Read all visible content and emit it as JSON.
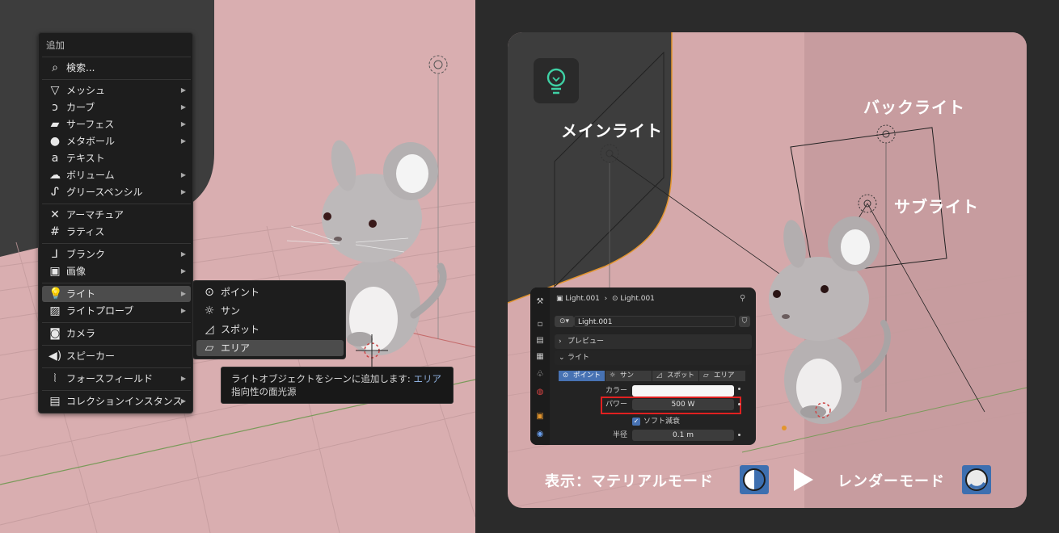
{
  "add_menu": {
    "title": "追加",
    "search": "検索...",
    "items": [
      {
        "label": "メッシュ",
        "icon": "mesh-icon",
        "has_submenu": true
      },
      {
        "label": "カーブ",
        "icon": "curve-icon",
        "has_submenu": true
      },
      {
        "label": "サーフェス",
        "icon": "surface-icon",
        "has_submenu": true
      },
      {
        "label": "メタボール",
        "icon": "metaball-icon",
        "has_submenu": true
      },
      {
        "label": "テキスト",
        "icon": "text-icon",
        "has_submenu": false
      },
      {
        "label": "ボリューム",
        "icon": "volume-icon",
        "has_submenu": true
      },
      {
        "label": "グリースペンシル",
        "icon": "grease-pencil-icon",
        "has_submenu": true
      },
      {
        "label": "アーマチュア",
        "icon": "armature-icon",
        "has_submenu": false
      },
      {
        "label": "ラティス",
        "icon": "lattice-icon",
        "has_submenu": false
      },
      {
        "label": "ブランク",
        "icon": "empty-icon",
        "has_submenu": true
      },
      {
        "label": "画像",
        "icon": "image-icon",
        "has_submenu": true
      },
      {
        "label": "ライト",
        "icon": "light-icon",
        "has_submenu": true,
        "active": true
      },
      {
        "label": "ライトプローブ",
        "icon": "light-probe-icon",
        "has_submenu": true
      },
      {
        "label": "カメラ",
        "icon": "camera-icon",
        "has_submenu": false
      },
      {
        "label": "スピーカー",
        "icon": "speaker-icon",
        "has_submenu": false
      },
      {
        "label": "フォースフィールド",
        "icon": "force-field-icon",
        "has_submenu": true
      },
      {
        "label": "コレクションインスタンス",
        "icon": "collection-icon",
        "has_submenu": true
      }
    ]
  },
  "light_submenu": {
    "items": [
      {
        "label": "ポイント",
        "icon": "point-light-icon"
      },
      {
        "label": "サン",
        "icon": "sun-light-icon"
      },
      {
        "label": "スポット",
        "icon": "spot-light-icon"
      },
      {
        "label": "エリア",
        "icon": "area-light-icon",
        "highlighted": true
      }
    ]
  },
  "tooltip": {
    "text": "ライトオブジェクトをシーンに追加します:",
    "highlight": "エリア",
    "line2": "指向性の面光源"
  },
  "scene_labels": {
    "main_light": "メインライト",
    "back_light": "バックライト",
    "sub_light": "サブライト"
  },
  "properties": {
    "breadcrumb_object": "Light.001",
    "breadcrumb_data": "Light.001",
    "datablock_name": "Light.001",
    "preview_label": "プレビュー",
    "light_label": "ライト",
    "types": [
      "ポイント",
      "サン",
      "スポット",
      "エリア"
    ],
    "active_type": "ポイント",
    "color_label": "カラー",
    "power_label": "パワー",
    "power_value": "500 W",
    "soft_falloff_label": "ソフト減衰",
    "radius_label": "半径",
    "radius_value": "0.1 m"
  },
  "footer": {
    "left_label": "表示：マテリアルモード",
    "right_label": "レンダーモード"
  },
  "colors": {
    "accent_blue": "#4772b3",
    "highlight_red": "#e02020",
    "light_icon_green": "#3fd1a5"
  }
}
